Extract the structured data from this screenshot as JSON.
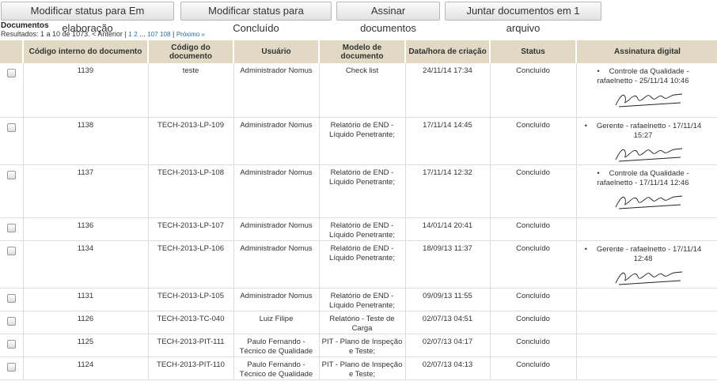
{
  "toolbar": {
    "btn_elaboracao": "Modificar status para Em elaboração",
    "btn_concluido": "Modificar status para Concluído",
    "btn_assinar": "Assinar documentos",
    "btn_juntar": "Juntar documentos em 1 arquivo"
  },
  "section_title": "Documentos",
  "pagination": {
    "results_text": "Resultados: 1 a 10 de 1073.",
    "prev": "< Anterior",
    "sep1": "|",
    "p1": "1",
    "p2": "2",
    "ellipsis": "...",
    "p107": "107",
    "p108": "108",
    "sep2": "|",
    "next": "Próximo »"
  },
  "table": {
    "headers": [
      "Código interno do documento",
      "Código do documento",
      "Usuário",
      "Modelo de documento",
      "Data/hora de criação",
      "Status",
      "Assinatura digital"
    ],
    "rows": [
      {
        "id": "1139",
        "code": "teste",
        "user": "Administrador Nomus",
        "model": "Check list",
        "date": "24/11/14 17:34",
        "status": "Concluído",
        "sig": "Controle da Qualidade - rafaelnetto - 25/11/14 10:46"
      },
      {
        "id": "1138",
        "code": "TECH-2013-LP-109",
        "user": "Administrador Nomus",
        "model": "Relatório de END - Líquido Penetrante;",
        "date": "17/11/14 14:45",
        "status": "Concluído",
        "sig": "Gerente - rafaelnetto - 17/11/14 15:27"
      },
      {
        "id": "1137",
        "code": "TECH-2013-LP-108",
        "user": "Administrador Nomus",
        "model": "Relatório de END - Líquido Penetrante;",
        "date": "17/11/14 12:32",
        "status": "Concluído",
        "sig": "Controle da Qualidade - rafaelnetto - 17/11/14 12:46"
      },
      {
        "id": "1136",
        "code": "TECH-2013-LP-107",
        "user": "Administrador Nomus",
        "model": "Relatório de END - Líquido Penetrante;",
        "date": "14/01/14 20:41",
        "status": "Concluído",
        "sig": ""
      },
      {
        "id": "1134",
        "code": "TECH-2013-LP-106",
        "user": "Administrador Nomus",
        "model": "Relatório de END - Líquido Penetrante;",
        "date": "18/09/13 11:37",
        "status": "Concluído",
        "sig": "Gerente - rafaelnetto - 17/11/14 12:48"
      },
      {
        "id": "1131",
        "code": "TECH-2013-LP-105",
        "user": "Administrador Nomus",
        "model": "Relatório de END - Líquido Penetrante;",
        "date": "09/09/13 11:55",
        "status": "Concluído",
        "sig": ""
      },
      {
        "id": "1126",
        "code": "TECH-2013-TC-040",
        "user": "Luiz Filipe",
        "model": "Relatório - Teste de Carga",
        "date": "02/07/13 04:51",
        "status": "Concluído",
        "sig": ""
      },
      {
        "id": "1125",
        "code": "TECH-2013-PIT-111",
        "user": "Paulo Fernando - Técnico de Qualidade",
        "model": "PIT - Plano de Inspeção e Teste;",
        "date": "02/07/13 04:17",
        "status": "Concluído",
        "sig": ""
      },
      {
        "id": "1124",
        "code": "TECH-2013-PIT-110",
        "user": "Paulo Fernando - Técnico de Qualidade",
        "model": "PIT - Plano de Inspeção e Teste;",
        "date": "02/07/13 04:13",
        "status": "Concluído",
        "sig": ""
      }
    ]
  }
}
